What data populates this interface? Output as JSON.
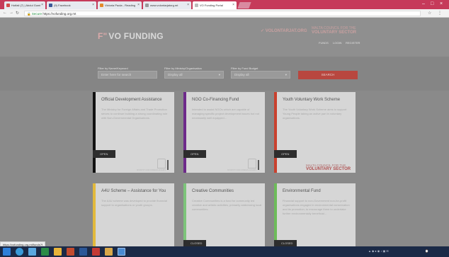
{
  "browser": {
    "tabs": [
      {
        "label": "Hotfail (7) | Abdul Gomi"
      },
      {
        "label": "(9) Facebook"
      },
      {
        "label": "Victoria Paola - Reading"
      },
      {
        "label": "www.volontarjatorg.mt"
      },
      {
        "label": "VO Funding Portal"
      }
    ],
    "url": "https://vofunding.org.mt",
    "secure_label": "Secure",
    "status_url": "https://vofunding.org.mt/funds?f"
  },
  "site": {
    "logo_text": "VO FUNDING",
    "partner_primary": "VOLONTARJAT.ORG",
    "partner_secondary": [
      "MALTA COUNCIL FOR THE",
      "VOLUNTARY SECTOR"
    ],
    "nav": [
      "FUNDS",
      "LOGIN",
      "REGISTER"
    ]
  },
  "filters": {
    "name_label": "Filter by Name/Keyword",
    "name_placeholder": "Enter here for search",
    "ministry_label": "Filter by Ministry/Organisation",
    "ministry_value": "Display all",
    "budget_label": "Filter by Fund Budget",
    "budget_value": "Display all",
    "search_label": "SEARCH"
  },
  "cards": [
    {
      "title": "Official Development Assistance",
      "description": "The Ministry for Foreign Affairs and Trade Promotion strives to continue building a strong coordinating role with Non-Governmental Organisations.",
      "status": "OPEN",
      "accent": "#111111"
    },
    {
      "title": "NGO Co-Financing Fund",
      "description": "Intended to assist NGOs which are capable of managing specific project development issues but not necessarily well equipped...",
      "status": "OPEN",
      "accent": "#6d2a8a"
    },
    {
      "title": "Youth Voluntary Work Scheme",
      "description": "The Youth Voluntary Work Scheme aims to support Young People taking an active part in voluntary organisations.",
      "status": "OPEN",
      "accent": "#c9402e"
    },
    {
      "title": "A4U Scheme – Assistance for You",
      "description": "The A4U scheme was developed to provide financial support to organisations or youth groups.",
      "status": "",
      "accent": "#e2b93c"
    },
    {
      "title": "Creative Communities",
      "description": "Creative Communities is a fund for community led creative and artistic activities, primarily addressing local communities.",
      "status": "CLOSED",
      "accent": "#7dc47a"
    },
    {
      "title": "Environmental Fund",
      "description": "Financial support to non-Government non-for-profit organisations engaged in environmental conservation and its promotion, to encourage them to undertake further environmentally beneficial...",
      "status": "CLOSED",
      "accent": "#6dbb5a"
    }
  ],
  "card_footer_small": "MINISTRY FOR FOREIGN AFFAIRS",
  "vs_footer": [
    "MALTA COUNCIL FOR THE",
    "VOLUNTARY SECTOR"
  ]
}
